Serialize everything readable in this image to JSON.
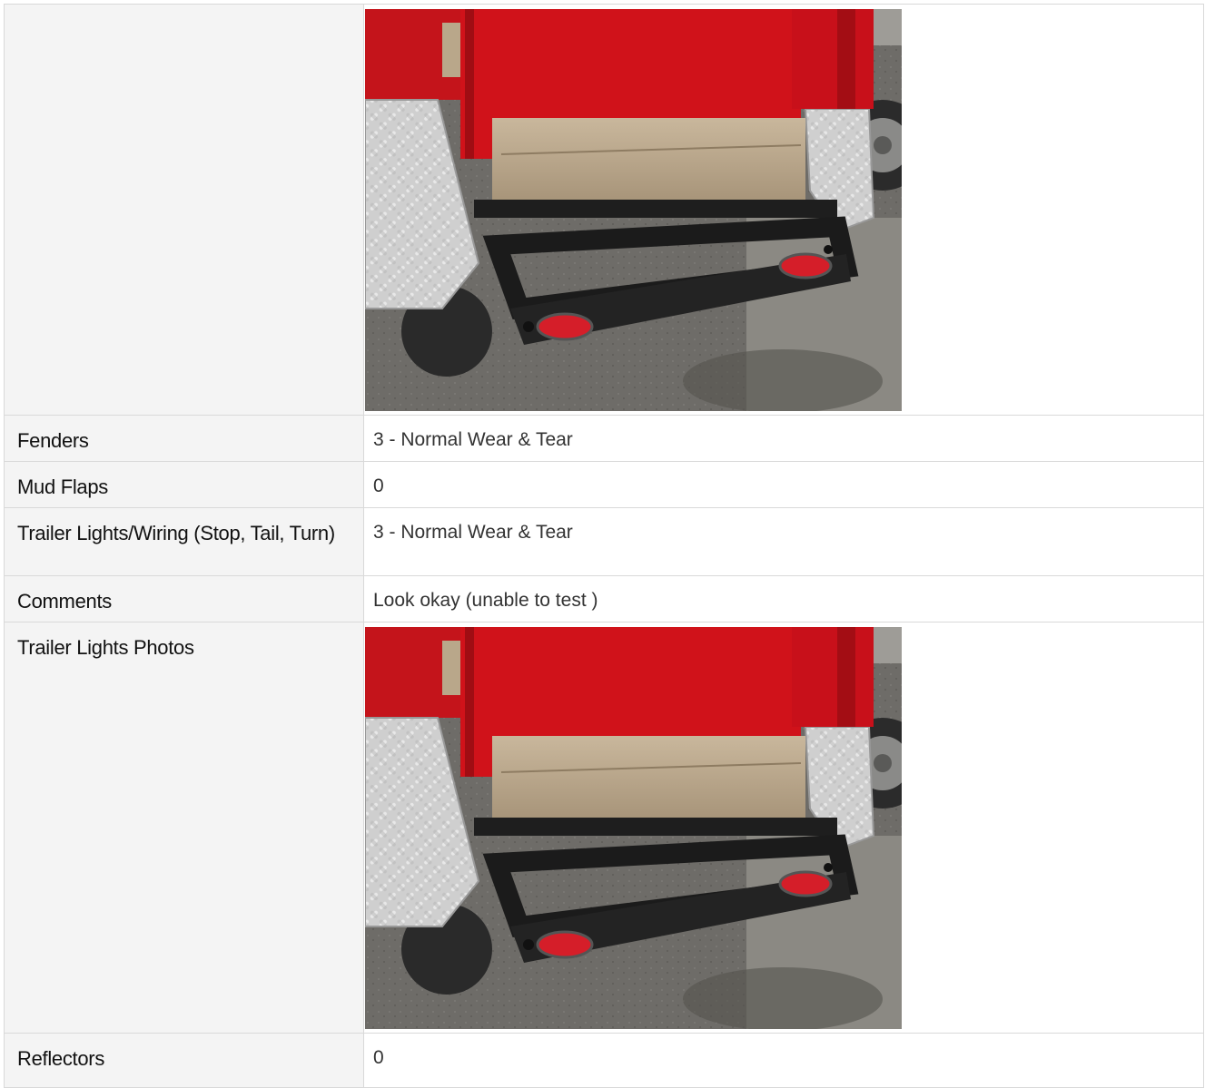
{
  "rows": [
    {
      "label": "",
      "type": "photo",
      "photo_description": "rear-of-red-trailer-with-diamond-plate-fenders-and-tail-lights"
    },
    {
      "label": "Fenders",
      "value": "3 - Normal Wear & Tear"
    },
    {
      "label": "Mud Flaps",
      "value": "0"
    },
    {
      "label": "Trailer Lights/Wiring (Stop, Tail, Turn)",
      "value": "3 - Normal Wear & Tear"
    },
    {
      "label": "Comments",
      "value": "Look okay (unable to test )"
    },
    {
      "label": "Trailer Lights Photos",
      "type": "photo",
      "photo_description": "rear-of-red-trailer-with-diamond-plate-fenders-and-tail-lights"
    },
    {
      "label": "Reflectors",
      "value": "0"
    }
  ],
  "colors": {
    "label_bg": "#f4f4f4",
    "border": "#d9d9d9",
    "trailer_red": "#d0121a",
    "plate_silver": "#c9c9c9",
    "asphalt": "#6f6d69"
  }
}
